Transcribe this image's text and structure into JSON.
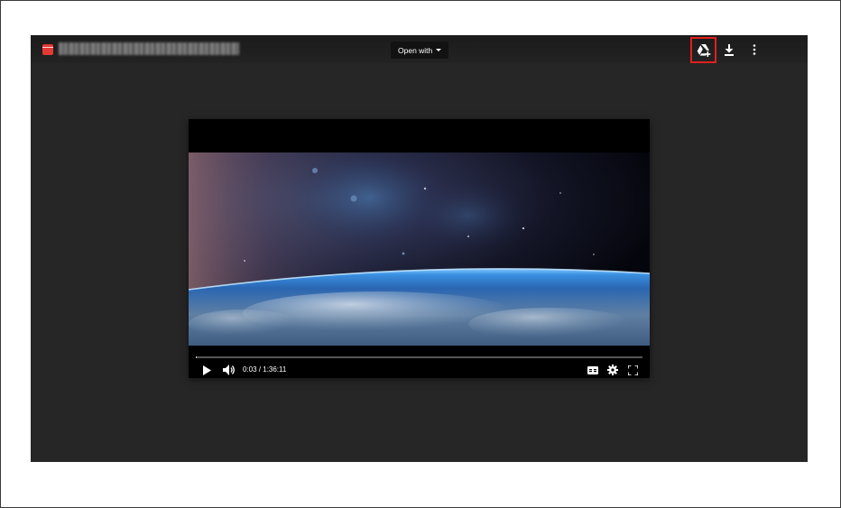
{
  "topbar": {
    "file_name": "",
    "open_with_label": "Open with",
    "icons": {
      "file": "video-file-icon",
      "add_to_drive": "add-to-drive-icon",
      "download": "download-icon",
      "more": "more-vertical-icon",
      "dropdown": "caret-down-icon"
    }
  },
  "player": {
    "time_display": "0:03 / 1:36:11",
    "progress": 0.0006,
    "icons": {
      "play": "play-icon",
      "volume": "volume-icon",
      "captions": "closed-captions-icon",
      "settings": "settings-gear-icon",
      "fullscreen": "fullscreen-icon"
    }
  },
  "colors": {
    "viewer_background": "#262626",
    "topbar_background": "#1b1b1b",
    "highlight_border": "#e02020",
    "file_icon": "#e53935"
  }
}
